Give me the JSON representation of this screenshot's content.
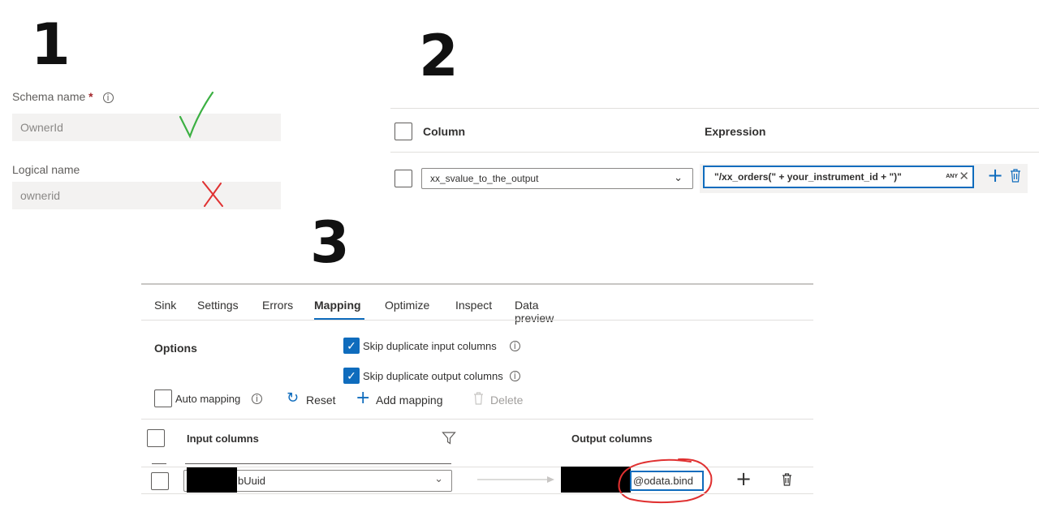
{
  "markers": {
    "one": "1",
    "two": "2",
    "three": "3"
  },
  "panel1": {
    "schema_label": "Schema name",
    "required_mark": "*",
    "schema_value": "OwnerId",
    "logical_label": "Logical name",
    "logical_value": "ownerid"
  },
  "panel2": {
    "col_header": "Column",
    "expr_header": "Expression",
    "column_value": "xx_svalue_to_the_output",
    "expression_value": "\"/xx_orders(\" + your_instrument_id + \")\"",
    "type_badge": "ANY"
  },
  "panel3": {
    "tabs": [
      "Sink",
      "Settings",
      "Errors",
      "Mapping",
      "Optimize",
      "Inspect",
      "Data preview"
    ],
    "options_label": "Options",
    "skip_input": "Skip duplicate input columns",
    "skip_output": "Skip duplicate output columns",
    "auto_mapping": "Auto mapping",
    "reset": "Reset",
    "add_mapping": "Add mapping",
    "delete": "Delete",
    "input_header": "Input columns",
    "output_header": "Output columns",
    "input_value_visible": "bUuid",
    "output_value_visible": "@odata.bind"
  },
  "annotations": {
    "check": "green-checkmark",
    "cross": "red-cross",
    "circle": "red-circle"
  }
}
